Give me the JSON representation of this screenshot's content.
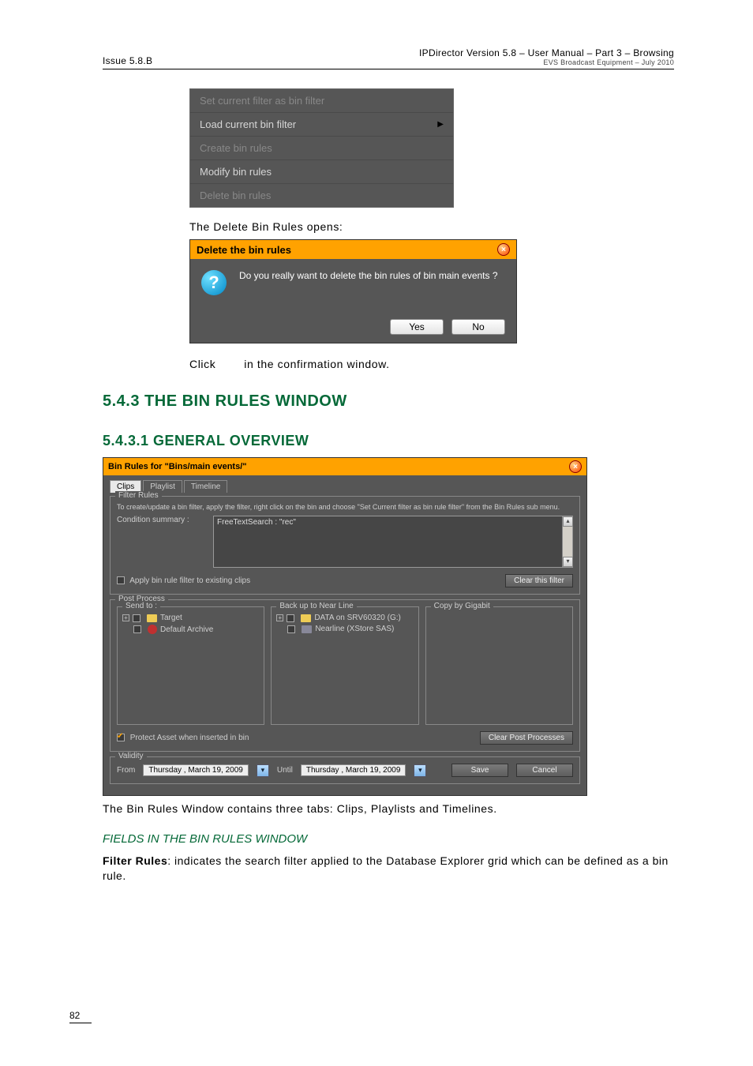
{
  "header": {
    "issue": "Issue 5.8.B",
    "product": "IPDirector Version 5.8 – User Manual – Part 3 – Browsing",
    "sub": "EVS Broadcast Equipment – July 2010"
  },
  "context_menu": {
    "items": [
      {
        "label": "Set current filter as bin filter",
        "enabled": false,
        "submenu": false
      },
      {
        "label": "Load current bin filter",
        "enabled": true,
        "submenu": true
      },
      {
        "label": "Create bin rules",
        "enabled": false,
        "submenu": false
      },
      {
        "label": "Modify bin rules",
        "enabled": true,
        "submenu": false
      },
      {
        "label": "Delete bin rules",
        "enabled": false,
        "submenu": false
      }
    ]
  },
  "text": {
    "delete_opens": "The Delete Bin Rules opens:",
    "confirm_click": "Click",
    "confirm_suffix": " in the confirmation window.",
    "tabs_desc": "The Bin Rules Window contains three tabs: Clips, Playlists and Timelines."
  },
  "dialog": {
    "title": "Delete the bin rules",
    "message": "Do you really want to delete the bin rules of bin main events ?",
    "yes": "Yes",
    "no": "No",
    "icon": "?"
  },
  "sections": {
    "chap": "5.4.3 THE BIN RULES WINDOW",
    "sub": "5.4.3.1 GENERAL OVERVIEW"
  },
  "brw": {
    "title": "Bin Rules for \"Bins/main events/\"",
    "tabs": [
      "Clips",
      "Playlist",
      "Timeline"
    ],
    "filter": {
      "legend": "Filter Rules",
      "help": "To create/update a bin filter, apply the filter, right click on the bin and choose \"Set Current filter as bin rule filter\" from the Bin Rules sub menu.",
      "cond_label": "Condition summary :",
      "cond_value": "FreeTextSearch : \"rec\"",
      "apply_label": "Apply bin rule filter to existing clips",
      "clear": "Clear this filter"
    },
    "post": {
      "legend": "Post Process",
      "sendto": {
        "legend": "Send to :",
        "items": [
          "Target",
          "Default Archive"
        ]
      },
      "backup": {
        "legend": "Back up to Near Line",
        "items": [
          "DATA on SRV60320 (G:)",
          "Nearline (XStore SAS)"
        ]
      },
      "copy": {
        "legend": "Copy by Gigabit"
      },
      "protect_label": "Protect Asset when inserted in bin",
      "clear_post": "Clear Post Processes"
    },
    "validity": {
      "legend": "Validity",
      "from": "From",
      "until": "Until",
      "date": "Thursday  ,    March    19, 2009",
      "save": "Save",
      "cancel": "Cancel"
    }
  },
  "fields": {
    "heading": "FIELDS IN THE BIN RULES WINDOW",
    "item_name": "Filter Rules",
    "item_desc": ": indicates the search filter applied to the Database Explorer grid which can be defined as a bin rule."
  },
  "page_number": "82"
}
